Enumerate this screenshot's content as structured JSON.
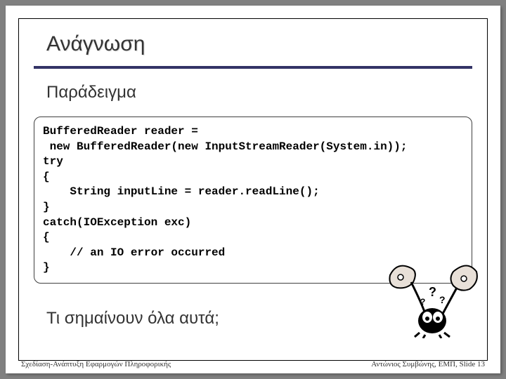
{
  "title": "Ανάγνωση",
  "subtitle": "Παράδειγμα",
  "code": "BufferedReader reader =\n new BufferedReader(new InputStreamReader(System.in));\ntry\n{\n    String inputLine = reader.readLine();\n}\ncatch(IOException exc)\n{\n    // an IO error occurred\n}",
  "question": "Τι σημαίνουν όλα αυτά;",
  "footer": {
    "left": "Σχεδίαση-Ανάπτυξη Εφαρμογών Πληροφορικής",
    "right": "Αντώνιος Συμβώνης, ΕΜΠ, Slide 13"
  }
}
